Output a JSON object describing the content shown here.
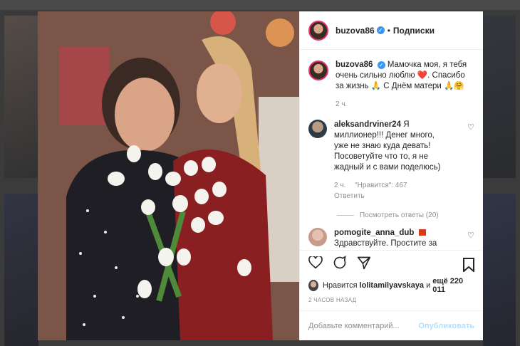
{
  "post": {
    "username": "buzova86",
    "follow_label": "Подписки",
    "caption": "Мамочка моя, я тебя очень сильно люблю ❤️. Спасибо за жизнь 🙏 С Днём матери 🙏🤗",
    "caption_time": "2 ч."
  },
  "comments": [
    {
      "username": "aleksandrviner24",
      "text": "Я миллионер!!! Денег много, уже не знаю куда девать! Посоветуйте что то, я не жадный и с вами поделюсь)",
      "time": "2 ч.",
      "likes": "\"Нравится\": 467",
      "reply_label": "Ответить",
      "view_replies": "Посмотреть ответы (20)"
    },
    {
      "username": "pomogite_anna_dub",
      "text": "Здравствуйте. Простите за такое сообщение, но это крик о помощи. Я умираю от рака (Рак молочной железы с"
    }
  ],
  "likes_line": {
    "prefix": "Нравится",
    "user": "lolitamilyavskaya",
    "and": "и",
    "others": "ещё 220 011"
  },
  "timestamp": "2 ЧАСОВ НАЗАД",
  "add_comment": {
    "placeholder": "Добавьте комментарий...",
    "publish": "Опубликовать"
  },
  "icons": [
    "heart-icon",
    "comment-icon",
    "share-icon",
    "bookmark-icon",
    "verified-icon"
  ],
  "colors": {
    "verified": "#3897f0",
    "story_ring": "#e1306c",
    "publish": "#b2dffc"
  }
}
